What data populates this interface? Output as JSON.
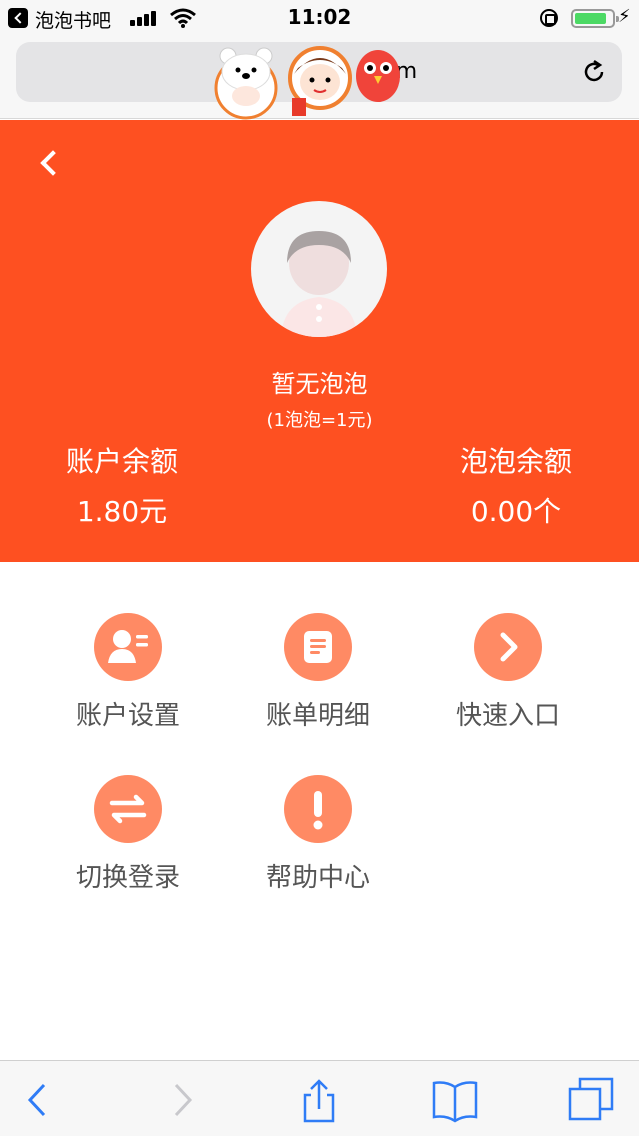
{
  "status_bar": {
    "app_name": "泡泡书吧",
    "time": "11:02",
    "battery_level": 0.85
  },
  "address_bar": {
    "text": "m"
  },
  "profile": {
    "bubble_status": "暂无泡泡",
    "bubble_rate": "(1泡泡=1元)",
    "account_balance_label": "账户余额",
    "account_balance_value": "1.80元",
    "bubble_balance_label": "泡泡余额",
    "bubble_balance_value": "0.00个"
  },
  "menu": {
    "items": [
      {
        "label": "账户设置",
        "icon": "user-card-icon"
      },
      {
        "label": "账单明细",
        "icon": "document-icon"
      },
      {
        "label": "快速入口",
        "icon": "chevron-right-icon"
      },
      {
        "label": "切换登录",
        "icon": "swap-icon"
      },
      {
        "label": "帮助中心",
        "icon": "exclamation-icon"
      }
    ]
  },
  "colors": {
    "header_bg": "#fe5021",
    "menu_icon_bg": "#ff8a64",
    "browser_blue": "#2f7cf6"
  }
}
